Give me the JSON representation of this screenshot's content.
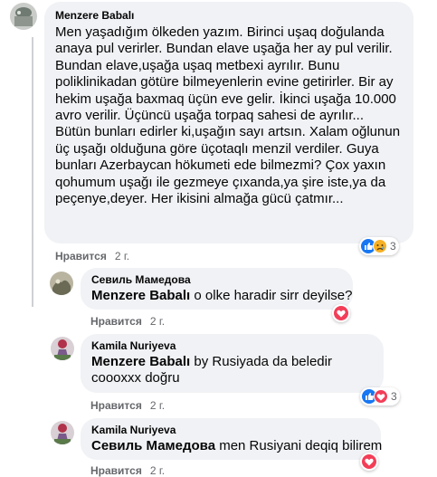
{
  "comments": [
    {
      "author": "Menzere Babalı",
      "mention": "",
      "text": "Men yaşadığım ölkeden yazım. Birinci uşaq doğulanda anaya pul verirler. Bundan elave uşağa her ay pul verilir. Bundan elave,uşağa uşaq metbexi ayrılır. Bunu poliklinikadan götüre bilmeyenlerin evine getirirler. Bir ay hekim uşağa baxmaq üçün eve gelir. İkinci uşağa 10.000 avro verilir. Üçüncü uşağa torpaq sahesi de ayrılır... Bütün bunları edirler ki,uşağın sayı artsın. Xalam oğlunun üç uşağı olduğuna göre üçotaqlı menzil verdiler. Guya bunları Azerbaycan hökumeti ede bilmezmi? Çox yaxın qohumum uşağı ile gezmeye çıxanda,ya şire iste,ya da peçenye,deyer. Her ikisini almağa gücü çatmır...",
      "like_label": "Нравится",
      "time": "2 г.",
      "reactions": [
        "like",
        "sad"
      ],
      "reaction_count": "3"
    },
    {
      "author": "Севиль Мамедова",
      "mention": "Menzere Babalı",
      "text": " o olke haradir sirr deyilse?",
      "like_label": "Нравится",
      "time": "2 г.",
      "reactions": [
        "love"
      ],
      "reaction_count": ""
    },
    {
      "author": "Kamila Nuriyeva",
      "mention": "Menzere Babalı",
      "text": " by Rusiyada da beledir coooxxx doğru",
      "like_label": "Нравится",
      "time": "2 г.",
      "reactions": [
        "like",
        "love"
      ],
      "reaction_count": "3"
    },
    {
      "author": "Kamila Nuriyeva",
      "mention": "Севиль Мамедова",
      "text": " men Rusiyani deqiq bilirem",
      "like_label": "Нравится",
      "time": "2 г.",
      "reactions": [
        "love"
      ],
      "reaction_count": ""
    }
  ],
  "colors": {
    "bubble": "#f0f2f5",
    "secondary_text": "#65676b",
    "like_blue": "#1877f2",
    "love_red": "#f33e58",
    "sad_yellow": "#f7b125"
  }
}
